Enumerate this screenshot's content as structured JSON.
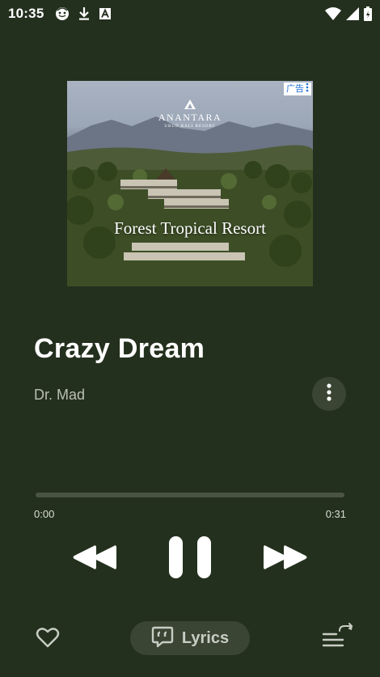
{
  "status_bar": {
    "time": "10:35",
    "left_icons": [
      "face-icon",
      "download-icon",
      "a-box-icon"
    ],
    "right_icons": [
      "wifi-icon",
      "signal-icon",
      "battery-icon"
    ]
  },
  "ad": {
    "badge_text": "广告",
    "brand": "ANANTARA",
    "brand_sub": "UBUD BALI RESORT",
    "headline": "Forest Tropical Resort"
  },
  "track": {
    "title": "Crazy Dream",
    "artist": "Dr. Mad",
    "elapsed": "0:00",
    "duration": "0:31",
    "progress_fraction": 0.0
  },
  "controls": {
    "prev_icon": "rewind-icon",
    "play_state_icon": "pause-icon",
    "next_icon": "fast-forward-icon"
  },
  "bottom": {
    "favorite_icon": "heart-icon",
    "lyrics_label": "Lyrics",
    "lyrics_icon": "lyrics-bubble-icon",
    "queue_icon": "queue-icon"
  },
  "colors": {
    "background": "#24301e",
    "pill": "#3a4534",
    "track": "#4a5444",
    "fill": "#d9ddd6",
    "ad_badge": "#1e6fd9"
  }
}
